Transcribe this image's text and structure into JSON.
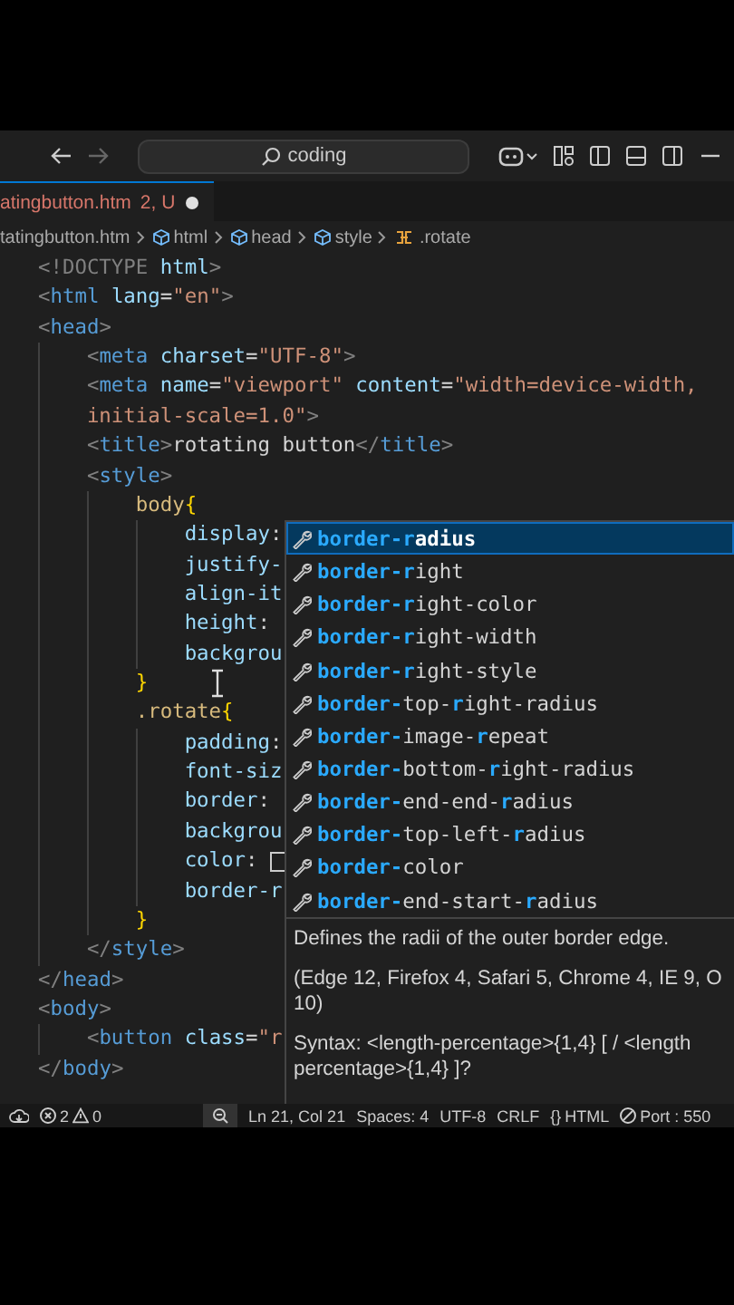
{
  "title_bar": {
    "search": {
      "value": "coding"
    }
  },
  "tab": {
    "filename": "atingbutton.htm",
    "status": "2, U",
    "modified": true,
    "selected": true
  },
  "breadcrumb": [
    {
      "label": "tatingbutton.htm",
      "kind": "file"
    },
    {
      "label": "html",
      "kind": "element"
    },
    {
      "label": "head",
      "kind": "element"
    },
    {
      "label": "style",
      "kind": "element"
    },
    {
      "label": ".rotate",
      "kind": "selector"
    }
  ],
  "editor": {
    "rows": [
      {
        "tokens": [
          {
            "text": "<!DOCTYPE",
            "kind": "punct"
          },
          {
            "text": " html",
            "kind": "attr"
          },
          {
            "text": ">",
            "kind": "punct"
          }
        ]
      },
      {
        "tokens": [
          {
            "text": "<",
            "kind": "punct"
          },
          {
            "text": "html",
            "kind": "tag"
          },
          {
            "text": " lang",
            "kind": "attr"
          },
          {
            "text": "=",
            "kind": "text"
          },
          {
            "text": "\"en\"",
            "kind": "string"
          },
          {
            "text": ">",
            "kind": "punct"
          }
        ]
      },
      {
        "tokens": [
          {
            "text": "<",
            "kind": "punct"
          },
          {
            "text": "head",
            "kind": "tag"
          },
          {
            "text": ">",
            "kind": "punct"
          }
        ]
      },
      {
        "tokens": [
          {
            "text": "    <",
            "kind": "punct"
          },
          {
            "text": "meta",
            "kind": "tag"
          },
          {
            "text": " charset",
            "kind": "attr"
          },
          {
            "text": "=",
            "kind": "text"
          },
          {
            "text": "\"UTF-8\"",
            "kind": "string"
          },
          {
            "text": ">",
            "kind": "punct"
          }
        ]
      },
      {
        "tokens": [
          {
            "text": "    <",
            "kind": "punct"
          },
          {
            "text": "meta",
            "kind": "tag"
          },
          {
            "text": " name",
            "kind": "attr"
          },
          {
            "text": "=",
            "kind": "text"
          },
          {
            "text": "\"viewport\"",
            "kind": "string"
          },
          {
            "text": " content",
            "kind": "attr"
          },
          {
            "text": "=",
            "kind": "text"
          },
          {
            "text": "\"width=device-width,",
            "kind": "string"
          }
        ]
      },
      {
        "tokens": [
          {
            "text": "    initial-scale=1.0\"",
            "kind": "string"
          },
          {
            "text": ">",
            "kind": "punct"
          }
        ]
      },
      {
        "tokens": [
          {
            "text": "    <",
            "kind": "punct"
          },
          {
            "text": "title",
            "kind": "tag"
          },
          {
            "text": ">",
            "kind": "punct"
          },
          {
            "text": "rotating button",
            "kind": "text"
          },
          {
            "text": "</",
            "kind": "punct"
          },
          {
            "text": "title",
            "kind": "tag"
          },
          {
            "text": ">",
            "kind": "punct"
          }
        ]
      },
      {
        "tokens": [
          {
            "text": "    <",
            "kind": "punct"
          },
          {
            "text": "style",
            "kind": "tag"
          },
          {
            "text": ">",
            "kind": "punct"
          }
        ]
      },
      {
        "tokens": [
          {
            "text": "        body",
            "kind": "selector"
          },
          {
            "text": "{",
            "kind": "brace"
          }
        ]
      },
      {
        "tokens": [
          {
            "text": "            display",
            "kind": "property"
          },
          {
            "text": ":",
            "kind": "text"
          }
        ]
      },
      {
        "tokens": [
          {
            "text": "            justify-",
            "kind": "property"
          }
        ]
      },
      {
        "tokens": [
          {
            "text": "            align-it",
            "kind": "property"
          }
        ]
      },
      {
        "tokens": [
          {
            "text": "            height",
            "kind": "property"
          },
          {
            "text": ":",
            "kind": "text"
          }
        ]
      },
      {
        "tokens": [
          {
            "text": "            backgrou",
            "kind": "property"
          }
        ]
      },
      {
        "tokens": [
          {
            "text": "        }",
            "kind": "brace"
          }
        ]
      },
      {
        "tokens": [
          {
            "text": "        .rotate",
            "kind": "selector"
          },
          {
            "text": "{",
            "kind": "brace"
          }
        ]
      },
      {
        "tokens": [
          {
            "text": "            padding",
            "kind": "property"
          },
          {
            "text": ":",
            "kind": "text"
          }
        ]
      },
      {
        "tokens": [
          {
            "text": "            font-siz",
            "kind": "property"
          }
        ]
      },
      {
        "tokens": [
          {
            "text": "            border",
            "kind": "property"
          },
          {
            "text": ":",
            "kind": "text"
          }
        ]
      },
      {
        "tokens": [
          {
            "text": "            backgrou",
            "kind": "property"
          }
        ]
      },
      {
        "tokens": [
          {
            "text": "            color",
            "kind": "property"
          },
          {
            "text": ": ",
            "kind": "text"
          },
          {
            "kind": "swatch"
          }
        ]
      },
      {
        "tokens": [
          {
            "text": "            border-r",
            "kind": "property"
          }
        ]
      },
      {
        "tokens": [
          {
            "text": "        }",
            "kind": "brace"
          }
        ]
      },
      {
        "tokens": [
          {
            "text": "    </",
            "kind": "punct"
          },
          {
            "text": "style",
            "kind": "tag"
          },
          {
            "text": ">",
            "kind": "punct"
          }
        ]
      },
      {
        "tokens": [
          {
            "text": "</",
            "kind": "punct"
          },
          {
            "text": "head",
            "kind": "tag"
          },
          {
            "text": ">",
            "kind": "punct"
          }
        ]
      },
      {
        "tokens": [
          {
            "text": "<",
            "kind": "punct"
          },
          {
            "text": "body",
            "kind": "tag"
          },
          {
            "text": ">",
            "kind": "punct"
          }
        ]
      },
      {
        "tokens": [
          {
            "text": "    <",
            "kind": "punct"
          },
          {
            "text": "button",
            "kind": "tag"
          },
          {
            "text": " class",
            "kind": "attr"
          },
          {
            "text": "=",
            "kind": "text"
          },
          {
            "text": "\"r",
            "kind": "string"
          }
        ]
      },
      {
        "tokens": [
          {
            "text": "</",
            "kind": "punct"
          },
          {
            "text": "body",
            "kind": "tag"
          },
          {
            "text": ">",
            "kind": "punct"
          }
        ]
      }
    ]
  },
  "suggestions": [
    {
      "selected": true,
      "parts": [
        {
          "text": "border-r",
          "match": true
        },
        {
          "text": "adius",
          "match": false
        }
      ]
    },
    {
      "selected": false,
      "parts": [
        {
          "text": "border-r",
          "match": true
        },
        {
          "text": "ight",
          "match": false
        }
      ]
    },
    {
      "selected": false,
      "parts": [
        {
          "text": "border-r",
          "match": true
        },
        {
          "text": "ight-color",
          "match": false
        }
      ]
    },
    {
      "selected": false,
      "parts": [
        {
          "text": "border-r",
          "match": true
        },
        {
          "text": "ight-width",
          "match": false
        }
      ]
    },
    {
      "selected": false,
      "parts": [
        {
          "text": "border-r",
          "match": true
        },
        {
          "text": "ight-style",
          "match": false
        }
      ]
    },
    {
      "selected": false,
      "parts": [
        {
          "text": "border-",
          "match": true
        },
        {
          "text": "top-",
          "match": false
        },
        {
          "text": "r",
          "match": true
        },
        {
          "text": "ight-radius",
          "match": false
        }
      ]
    },
    {
      "selected": false,
      "parts": [
        {
          "text": "border-",
          "match": true
        },
        {
          "text": "image-",
          "match": false
        },
        {
          "text": "r",
          "match": true
        },
        {
          "text": "epeat",
          "match": false
        }
      ]
    },
    {
      "selected": false,
      "parts": [
        {
          "text": "border-",
          "match": true
        },
        {
          "text": "bottom-",
          "match": false
        },
        {
          "text": "r",
          "match": true
        },
        {
          "text": "ight-radius",
          "match": false
        }
      ]
    },
    {
      "selected": false,
      "parts": [
        {
          "text": "border-",
          "match": true
        },
        {
          "text": "end-end-",
          "match": false
        },
        {
          "text": "r",
          "match": true
        },
        {
          "text": "adius",
          "match": false
        }
      ]
    },
    {
      "selected": false,
      "parts": [
        {
          "text": "border-",
          "match": true
        },
        {
          "text": "top-left-",
          "match": false
        },
        {
          "text": "r",
          "match": true
        },
        {
          "text": "adius",
          "match": false
        }
      ]
    },
    {
      "selected": false,
      "parts": [
        {
          "text": "border-",
          "match": true
        },
        {
          "text": "color",
          "match": false
        }
      ]
    },
    {
      "selected": false,
      "parts": [
        {
          "text": "border-",
          "match": true
        },
        {
          "text": "end-start-",
          "match": false
        },
        {
          "text": "r",
          "match": true
        },
        {
          "text": "adius",
          "match": false
        }
      ]
    }
  ],
  "details": [
    {
      "lines": [
        "Defines the radii of the outer border edge."
      ]
    },
    {
      "lines": [
        "(Edge 12, Firefox 4, Safari 5, Chrome 4, IE 9, O",
        "10)"
      ]
    },
    {
      "lines": [
        "Syntax: <length-percentage>{1,4} [ / <length",
        "percentage>{1,4} ]?"
      ]
    }
  ],
  "status_bar": {
    "errors": "2",
    "warnings": "0",
    "position": "Ln 21, Col 21",
    "indent": "Spaces: 4",
    "encoding": "UTF-8",
    "eol": "CRLF",
    "language_braces": "{}",
    "language": "HTML",
    "port": "Port : 550"
  }
}
